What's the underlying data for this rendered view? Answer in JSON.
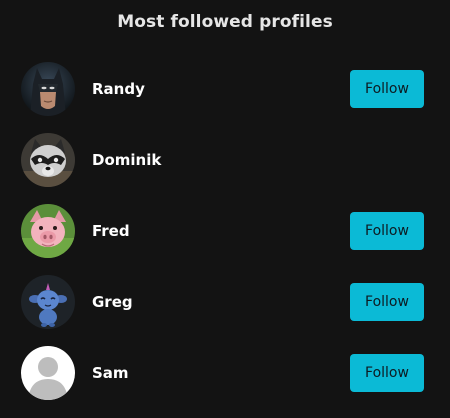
{
  "header": {
    "title": "Most followed profiles"
  },
  "accent_color": "#0bbad6",
  "profiles": [
    {
      "name": "Randy",
      "avatar_icon": "masked-hero-avatar-icon",
      "follow_label": "Follow",
      "show_follow": true
    },
    {
      "name": "Dominik",
      "avatar_icon": "raccoon-avatar-icon",
      "follow_label": "",
      "show_follow": false
    },
    {
      "name": "Fred",
      "avatar_icon": "pig-avatar-icon",
      "follow_label": "Follow",
      "show_follow": true
    },
    {
      "name": "Greg",
      "avatar_icon": "blue-creature-avatar-icon",
      "follow_label": "Follow",
      "show_follow": true
    },
    {
      "name": "Sam",
      "avatar_icon": "default-user-avatar-icon",
      "follow_label": "Follow",
      "show_follow": true
    }
  ]
}
